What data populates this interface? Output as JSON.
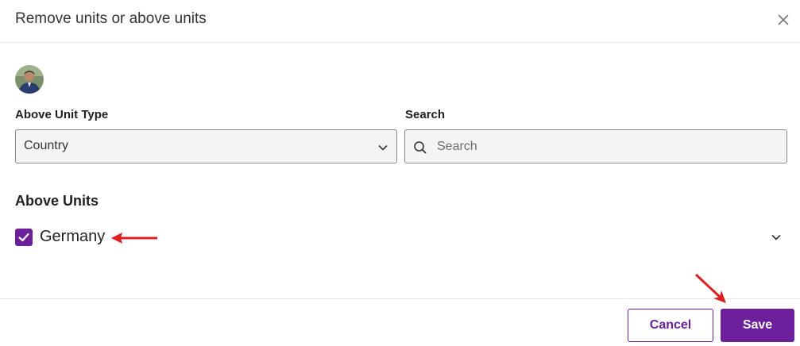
{
  "dialog": {
    "title": "Remove units or above units"
  },
  "form": {
    "above_unit_type_label": "Above Unit Type",
    "above_unit_type_value": "Country",
    "search_label": "Search",
    "search_placeholder": "Search"
  },
  "above_units": {
    "title": "Above Units",
    "items": [
      {
        "label": "Germany",
        "checked": true
      }
    ]
  },
  "footer": {
    "cancel_label": "Cancel",
    "save_label": "Save"
  },
  "colors": {
    "accent": "#6b1f9a",
    "annotation_arrow": "#e02020"
  },
  "icons": [
    "close-icon",
    "avatar",
    "chevron-down-icon",
    "search-icon",
    "checkmark-icon"
  ]
}
